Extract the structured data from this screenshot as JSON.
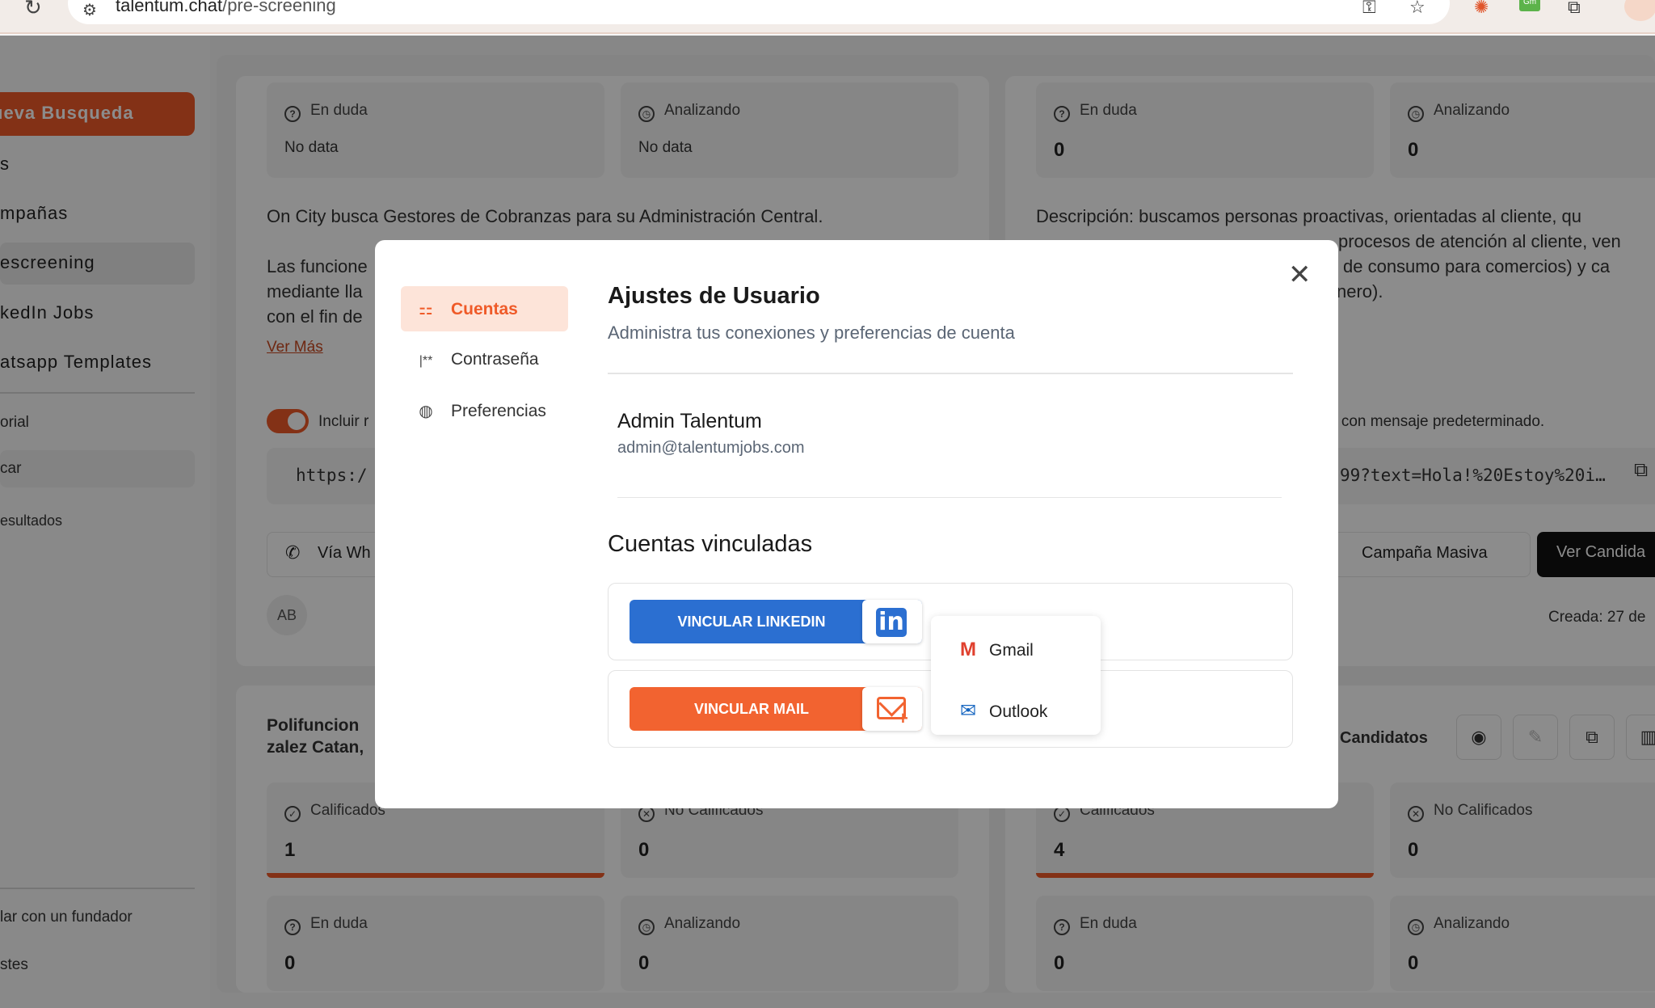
{
  "browser": {
    "url_host": "talentum.chat",
    "url_path": "/pre-screening",
    "ext_badge": "Gm"
  },
  "sidebar": {
    "new_search": "ueva Busqueda",
    "items": [
      {
        "label": "s"
      },
      {
        "label": "mpañas"
      },
      {
        "label": "escreening"
      },
      {
        "label": "kedIn Jobs"
      },
      {
        "label": "atsapp Templates"
      }
    ],
    "sub_items": [
      {
        "label": "orial"
      },
      {
        "label": "car"
      },
      {
        "label": "esultados"
      }
    ],
    "footer": [
      {
        "label": "lar con un fundador"
      },
      {
        "label": "stes"
      }
    ]
  },
  "left_card": {
    "stats": [
      {
        "label": "En duda",
        "value": "No data"
      },
      {
        "label": "Analizando",
        "value": "No data"
      }
    ],
    "description": "On City busca Gestores de Cobranzas para su Administración Central.",
    "line2": "Las funcione",
    "line3": "mediante lla",
    "line4": "con el fin de",
    "more": "Ver Más",
    "toggle_label": "Incluir r",
    "code": "https:/",
    "via": "Vía Wh",
    "avatar": "AB"
  },
  "right_card": {
    "stats": [
      {
        "label": "En duda",
        "value": "0"
      },
      {
        "label": "Analizando",
        "value": "0"
      }
    ],
    "description": "Descripción: buscamos personas proactivas, orientadas al cliente, qu",
    "line2": "procesos de atención al cliente, ven",
    "line3": "de consumo para comercios) y ca",
    "line4": "nero).",
    "toggle_text": "g con mensaje predeterminado.",
    "code": "99?text=Hola!%20Estoy%20i…",
    "btn_campaign": "Campaña Masiva",
    "btn_candidates": "Ver Candida",
    "created": "Creada: 27 de"
  },
  "bottom_left": {
    "title1": "Polifuncion",
    "title2": "zalez Catan,",
    "stats": [
      {
        "label": "Calificados",
        "value": "1"
      },
      {
        "label": "No Calificados",
        "value": "0"
      },
      {
        "label": "En duda",
        "value": "0"
      },
      {
        "label": "Analizando",
        "value": "0"
      }
    ]
  },
  "bottom_right": {
    "candidates_label": "Candidatos",
    "stats": [
      {
        "label": "Calificados",
        "value": "4"
      },
      {
        "label": "No Calificados",
        "value": "0"
      },
      {
        "label": "En duda",
        "value": "0"
      },
      {
        "label": "Analizando",
        "value": "0"
      }
    ]
  },
  "modal": {
    "tabs": [
      {
        "label": "Cuentas",
        "icon": "sitemap-icon"
      },
      {
        "label": "Contraseña",
        "icon": "password-icon"
      },
      {
        "label": "Preferencias",
        "icon": "globe-icon"
      }
    ],
    "title": "Ajustes de Usuario",
    "subtitle": "Administra tus conexiones y preferencias de cuenta",
    "user": {
      "name": "Admin Talentum",
      "email": "admin@talentumjobs.com"
    },
    "linked_title": "Cuentas vinculadas",
    "linkedin_button": "VINCULAR LINKEDIN",
    "mail_button": "VINCULAR MAIL",
    "mail_menu": [
      {
        "label": "Gmail"
      },
      {
        "label": "Outlook"
      }
    ]
  },
  "colors": {
    "accent": "#ef5a28",
    "linkedin_blue": "#2b6fd1",
    "mail_orange": "#f26330",
    "overlay": "rgba(0,0,0,0.45)"
  }
}
